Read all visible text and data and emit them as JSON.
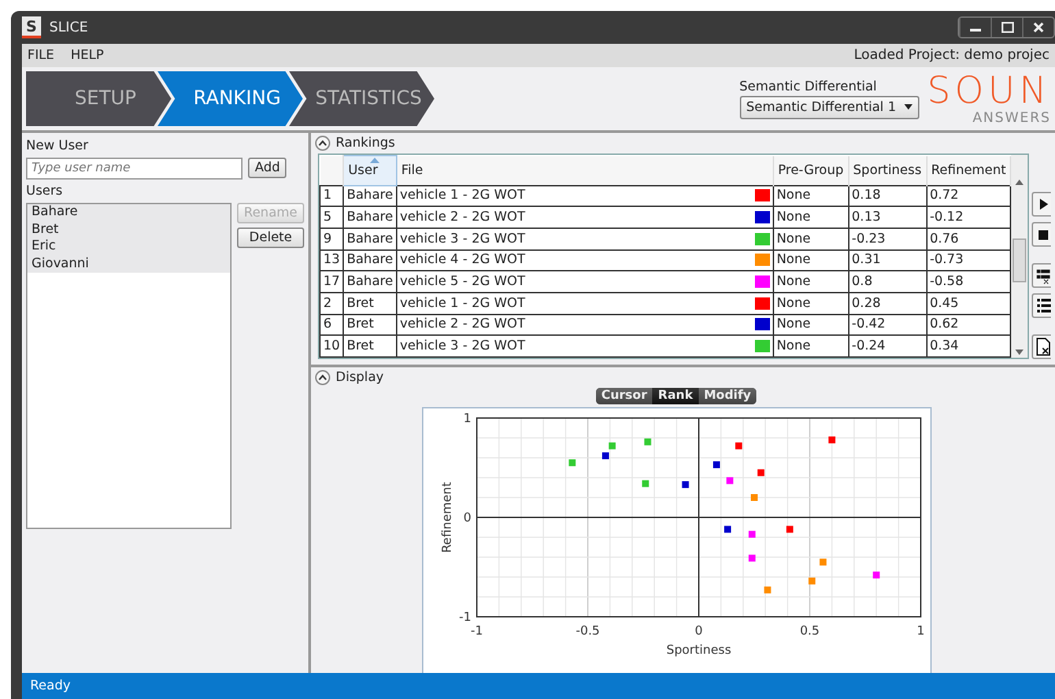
{
  "window": {
    "title": "SLICE",
    "icon_letter": "S"
  },
  "menu": [
    "FILE",
    "HELP"
  ],
  "loaded_project": "Loaded Project: demo projec",
  "steps": [
    {
      "label": "SETUP",
      "selected": false
    },
    {
      "label": "RANKING",
      "selected": true
    },
    {
      "label": "STATISTICS",
      "selected": false
    }
  ],
  "semantic_differential": {
    "label": "Semantic Differential",
    "value": "Semantic Differential 1"
  },
  "logo": {
    "word": "SOUN",
    "tagline": "ANSWERS"
  },
  "new_user": {
    "label": "New User",
    "placeholder": "Type user name",
    "button": "Add"
  },
  "users": {
    "label": "Users",
    "items": [
      "Bahare",
      "Bret",
      "Eric",
      "Giovanni"
    ],
    "buttons": [
      {
        "label": "Rename",
        "disabled": true
      },
      {
        "label": "Delete",
        "disabled": false
      }
    ]
  },
  "rankings": {
    "title": "Rankings",
    "columns": [
      {
        "sorted": false
      },
      {
        "label": "User",
        "sorted": true
      },
      {
        "label": "File",
        "sorted": false
      },
      {
        "label": "Pre-Group",
        "sorted": false
      },
      {
        "label": "Sportiness",
        "sorted": false
      },
      {
        "label": "Refinement",
        "sorted": false
      }
    ],
    "rows": [
      {
        "rank": "1",
        "user": "Bahare",
        "file": "vehicle 1 - 2G WOT",
        "color": "#ff0000",
        "pre_group": "None",
        "sportiness": "0.18",
        "refinement": "0.72"
      },
      {
        "rank": "5",
        "user": "Bahare",
        "file": "vehicle 2 - 2G WOT",
        "color": "#0000cc",
        "pre_group": "None",
        "sportiness": "0.13",
        "refinement": "-0.12"
      },
      {
        "rank": "9",
        "user": "Bahare",
        "file": "vehicle 3 - 2G WOT",
        "color": "#33cc33",
        "pre_group": "None",
        "sportiness": "-0.23",
        "refinement": "0.76"
      },
      {
        "rank": "13",
        "user": "Bahare",
        "file": "vehicle 4 - 2G WOT",
        "color": "#ff8c00",
        "pre_group": "None",
        "sportiness": "0.31",
        "refinement": "-0.73"
      },
      {
        "rank": "17",
        "user": "Bahare",
        "file": "vehicle 5 - 2G WOT",
        "color": "#ff00ff",
        "pre_group": "None",
        "sportiness": "0.8",
        "refinement": "-0.58"
      },
      {
        "rank": "2",
        "user": "Bret",
        "file": "vehicle 1 - 2G WOT",
        "color": "#ff0000",
        "pre_group": "None",
        "sportiness": "0.28",
        "refinement": "0.45"
      },
      {
        "rank": "6",
        "user": "Bret",
        "file": "vehicle 2 - 2G WOT",
        "color": "#0000cc",
        "pre_group": "None",
        "sportiness": "-0.42",
        "refinement": "0.62"
      },
      {
        "rank": "10",
        "user": "Bret",
        "file": "vehicle 3 - 2G WOT",
        "color": "#33cc33",
        "pre_group": "None",
        "sportiness": "-0.24",
        "refinement": "0.34"
      }
    ]
  },
  "display": {
    "title": "Display",
    "modes": [
      {
        "label": "Cursor",
        "selected": false
      },
      {
        "label": "Rank",
        "selected": true
      },
      {
        "label": "Modify",
        "selected": false
      }
    ],
    "chart_data": {
      "type": "scatter",
      "grid": true,
      "xlabel": "Sportiness",
      "ylabel": "Refinement",
      "xlim": [
        -1,
        1
      ],
      "ylim": [
        -1,
        1
      ],
      "xticks": [
        {
          "value": -1,
          "label": "-1"
        },
        {
          "value": -0.5,
          "label": "-0.5"
        },
        {
          "value": 0,
          "label": "0"
        },
        {
          "value": 0.5,
          "label": "0.5"
        },
        {
          "value": 1,
          "label": "1"
        }
      ],
      "yticks": [
        -1,
        0,
        1
      ],
      "series": [
        {
          "color": "#ff0000",
          "x": [
            0.18,
            0.28,
            0.6,
            0.41
          ],
          "values": [
            0.72,
            0.45,
            0.78,
            -0.12
          ]
        },
        {
          "color": "#0000cc",
          "x": [
            0.13,
            -0.42,
            0.08,
            -0.06
          ],
          "values": [
            -0.12,
            0.62,
            0.53,
            0.33
          ]
        },
        {
          "color": "#33cc33",
          "x": [
            -0.23,
            -0.24,
            -0.57,
            -0.39
          ],
          "values": [
            0.76,
            0.34,
            0.55,
            0.72
          ]
        },
        {
          "color": "#ff8c00",
          "x": [
            0.31,
            0.25,
            0.56,
            0.51
          ],
          "values": [
            -0.73,
            0.2,
            -0.45,
            -0.64
          ]
        },
        {
          "color": "#ff00ff",
          "x": [
            0.8,
            0.14,
            0.24,
            0.24
          ],
          "values": [
            -0.58,
            0.37,
            -0.17,
            -0.41
          ]
        }
      ]
    }
  },
  "status": "Ready"
}
